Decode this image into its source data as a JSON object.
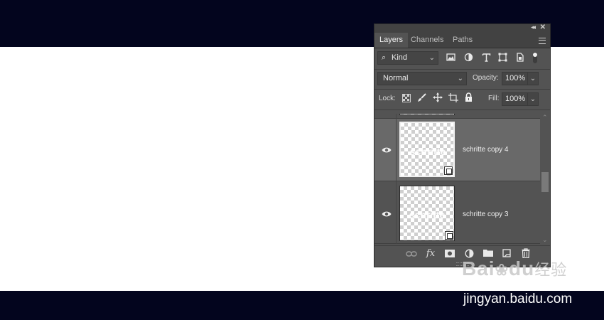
{
  "panel": {
    "tabs": [
      "Layers",
      "Channels",
      "Paths"
    ],
    "active_tab": "Layers",
    "filter": {
      "label": "Kind"
    },
    "blend_mode": "Normal",
    "opacity": {
      "label": "Opacity:",
      "value": "100%"
    },
    "lock": {
      "label": "Lock:"
    },
    "fill": {
      "label": "Fill:",
      "value": "100%"
    },
    "layers": [
      {
        "name": "schritte copy 4",
        "thumb_text": "schritte",
        "visible": true,
        "selected": true
      },
      {
        "name": "schritte copy 3",
        "thumb_text": "schritte",
        "visible": true,
        "selected": false
      }
    ],
    "bottom_icons": [
      "link-icon",
      "fx-icon",
      "mask-icon",
      "adjustment-icon",
      "folder-icon",
      "new-layer-icon",
      "trash-icon"
    ]
  },
  "watermark": {
    "logo": "Bai",
    "logo2": "du",
    "logo_cn": "经验",
    "url": "jingyan.baidu.com"
  },
  "colors": {
    "background_band": "#03051e",
    "panel": "#535353",
    "selected_layer": "#696969"
  }
}
